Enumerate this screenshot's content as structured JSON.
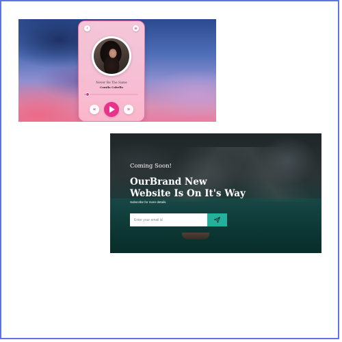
{
  "theme": {
    "frame_border": "#5a73e6",
    "player_accent": "#e8338a",
    "player_card_bg": "#fbc3d5",
    "landing_button": "#25b09b"
  },
  "player": {
    "top_left_icon": "chevron-left-icon",
    "top_right_icon": "menu-icon",
    "song_title": "Never Be The Same",
    "artist": "Camila Cabello",
    "progress": 0.05,
    "prev_label": "«",
    "next_label": "»",
    "play_icon": "play-icon"
  },
  "landing": {
    "kicker": "Coming Soon!",
    "headline_line1": "OurBrand New",
    "headline_line2": "Website Is On It's Way",
    "subnote": "Subscribe for more details.",
    "email_placeholder": "Enter your email id",
    "submit_icon": "paper-plane-icon"
  }
}
